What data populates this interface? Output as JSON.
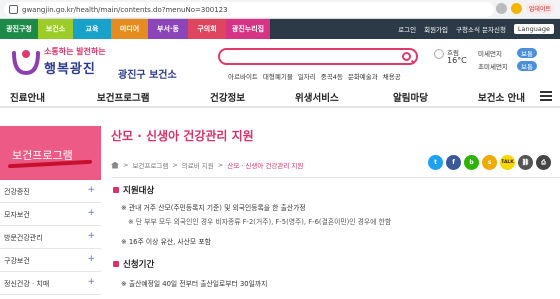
{
  "browser": {
    "url": "gwangjin.go.kr/health/main/contents.do?menuNo=300123",
    "update_label": "업데이트"
  },
  "topnav": {
    "tabs": [
      {
        "label": "광진구청",
        "color": "#1d8a4a"
      },
      {
        "label": "보건소",
        "color": "#9ccc28"
      },
      {
        "label": "교육",
        "color": "#18a1c9"
      },
      {
        "label": "미디어",
        "color": "#e48c20"
      },
      {
        "label": "부서·동",
        "color": "#8b45b8"
      },
      {
        "label": "구의회",
        "color": "#e0455f"
      },
      {
        "label": "광진누리집",
        "color": "#d63384"
      }
    ],
    "links": [
      "로그인",
      "회원가입",
      "구청소식 문자신청",
      "Language"
    ]
  },
  "header": {
    "logo_top": "소통하는 발전하는",
    "logo_main": "행복광진",
    "logo_sub": "광진구 보건소",
    "keywords": [
      "아르바이트",
      "대형폐기물",
      "일자리",
      "중곡4동",
      "문화예술과",
      "채용공"
    ],
    "weather_label": "흐림",
    "weather_temp": "16°C",
    "dust": [
      {
        "label": "미세먼지",
        "value": "보통"
      },
      {
        "label": "초미세먼지",
        "value": "보통"
      }
    ]
  },
  "mainmenu": [
    "진료안내",
    "보건프로그램",
    "건강정보",
    "위생서비스",
    "알림마당",
    "보건소 안내"
  ],
  "sidebar": {
    "title": "보건프로그램",
    "items": [
      "건강증진",
      "모자보건",
      "방문건강관리",
      "구강보건",
      "정신건강 · 치매"
    ]
  },
  "content": {
    "title": "산모 · 신생아 건강관리 지원",
    "breadcrumb": [
      "보건프로그램",
      "의료비 지원",
      "산모 · 신생아 건강관리 지원"
    ],
    "share": [
      {
        "name": "twitter-icon",
        "label": "t",
        "color": "#1da1f2"
      },
      {
        "name": "facebook-icon",
        "label": "f",
        "color": "#3b5998"
      },
      {
        "name": "blog-icon",
        "label": "b",
        "color": "#2db400"
      },
      {
        "name": "kakaostory-icon",
        "label": "s",
        "color": "#f2a900"
      },
      {
        "name": "talk-icon",
        "label": "TALK",
        "color": "#f7d800"
      },
      {
        "name": "link-icon",
        "label": "⛓",
        "color": "#555"
      },
      {
        "name": "print-icon",
        "label": "⎙",
        "color": "#444"
      }
    ],
    "section1_title": "지원대상",
    "section1_lines": [
      "※ 관내 거주 산모(주민등록지 기준) 및 외국인등록을 한 출산가정",
      "※ 단 부부 모두 외국인인 경우 비자종류 F-2(거주), F-5(영주), F-6(결혼이민)인 경우에 한함",
      "※ 16주 이상 유산, 사산모 포함"
    ],
    "section2_title": "신청기간",
    "section2_lines": [
      "※ 출산예정일 40일 전부터 출산일로부터 30일까지"
    ]
  }
}
